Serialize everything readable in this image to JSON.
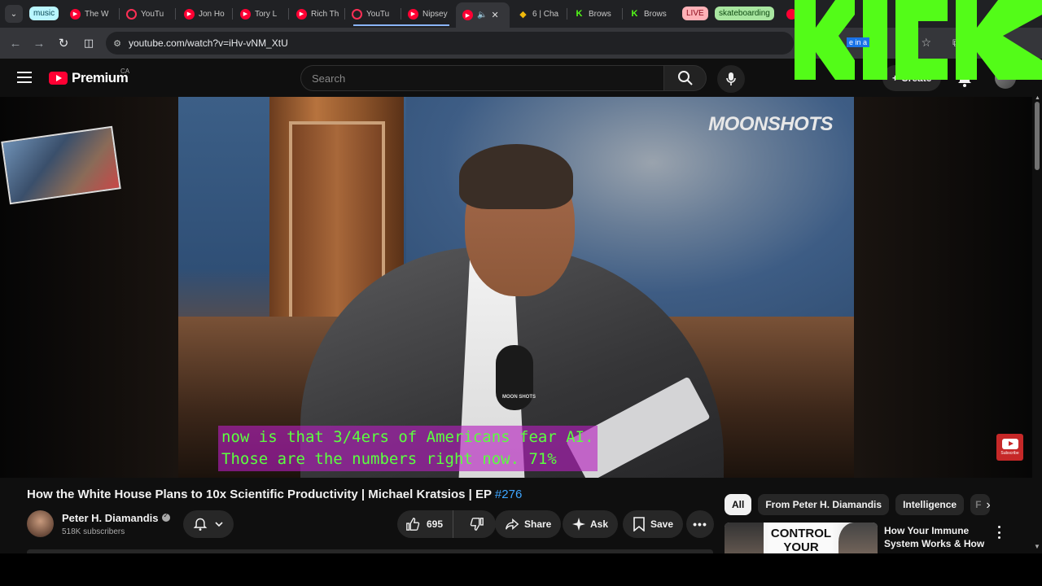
{
  "browser": {
    "tabs": [
      {
        "label": "music",
        "type": "group-chip"
      },
      {
        "label": "The W",
        "icon": "youtube-icon"
      },
      {
        "label": "YouTu",
        "icon": "youtube-music-icon"
      },
      {
        "label": "Jon Ho",
        "icon": "youtube-icon"
      },
      {
        "label": "Tory L",
        "icon": "youtube-icon"
      },
      {
        "label": "Rich Th",
        "icon": "youtube-icon"
      },
      {
        "label": "YouTu",
        "icon": "youtube-music-icon"
      },
      {
        "label": "Nipsey",
        "icon": "youtube-icon"
      },
      {
        "label": "6 | Cha",
        "icon": "binance-icon"
      },
      {
        "label": "Brows",
        "icon": "kick-icon"
      },
      {
        "label": "Brows",
        "icon": "kick-icon"
      },
      {
        "label": "LIVE",
        "type": "group-chip"
      },
      {
        "label": "skateboarding",
        "type": "group-chip"
      }
    ],
    "url": "youtube.com/watch?v=iHv-vNM_XtU",
    "overlay_note": "e in a"
  },
  "youtube": {
    "logo_text": "Premium",
    "region": "CA",
    "search_placeholder": "Search",
    "create_label": "Create"
  },
  "video": {
    "watermark": "MOONSHOTS",
    "mic_label": "MOON SHOTS",
    "captions": [
      "now is that 3/4ers of Americans fear AI.",
      "Those are the numbers right now. 71%"
    ],
    "subscribe_badge": "Subscribe",
    "title": "How the White House Plans to 10x Scientific Productivity | Michael Kratsios | EP ",
    "episode_tag": "#276",
    "channel": "Peter H. Diamandis",
    "subscribers": "518K subscribers",
    "likes": "695",
    "share_label": "Share",
    "ask_label": "Ask",
    "save_label": "Save"
  },
  "sidebar": {
    "chips": [
      "All",
      "From Peter H. Diamandis",
      "Intelligence",
      "F"
    ],
    "recommendation": {
      "thumb_text": "CONTROL YOUR",
      "title": "How Your Immune System Works & How t..."
    }
  },
  "colors": {
    "kick_green": "#53fc18",
    "youtube_red": "#ff0033",
    "caption_text": "#5bff3f",
    "caption_bg": "#b41ebe",
    "link_blue": "#3ea6ff"
  }
}
